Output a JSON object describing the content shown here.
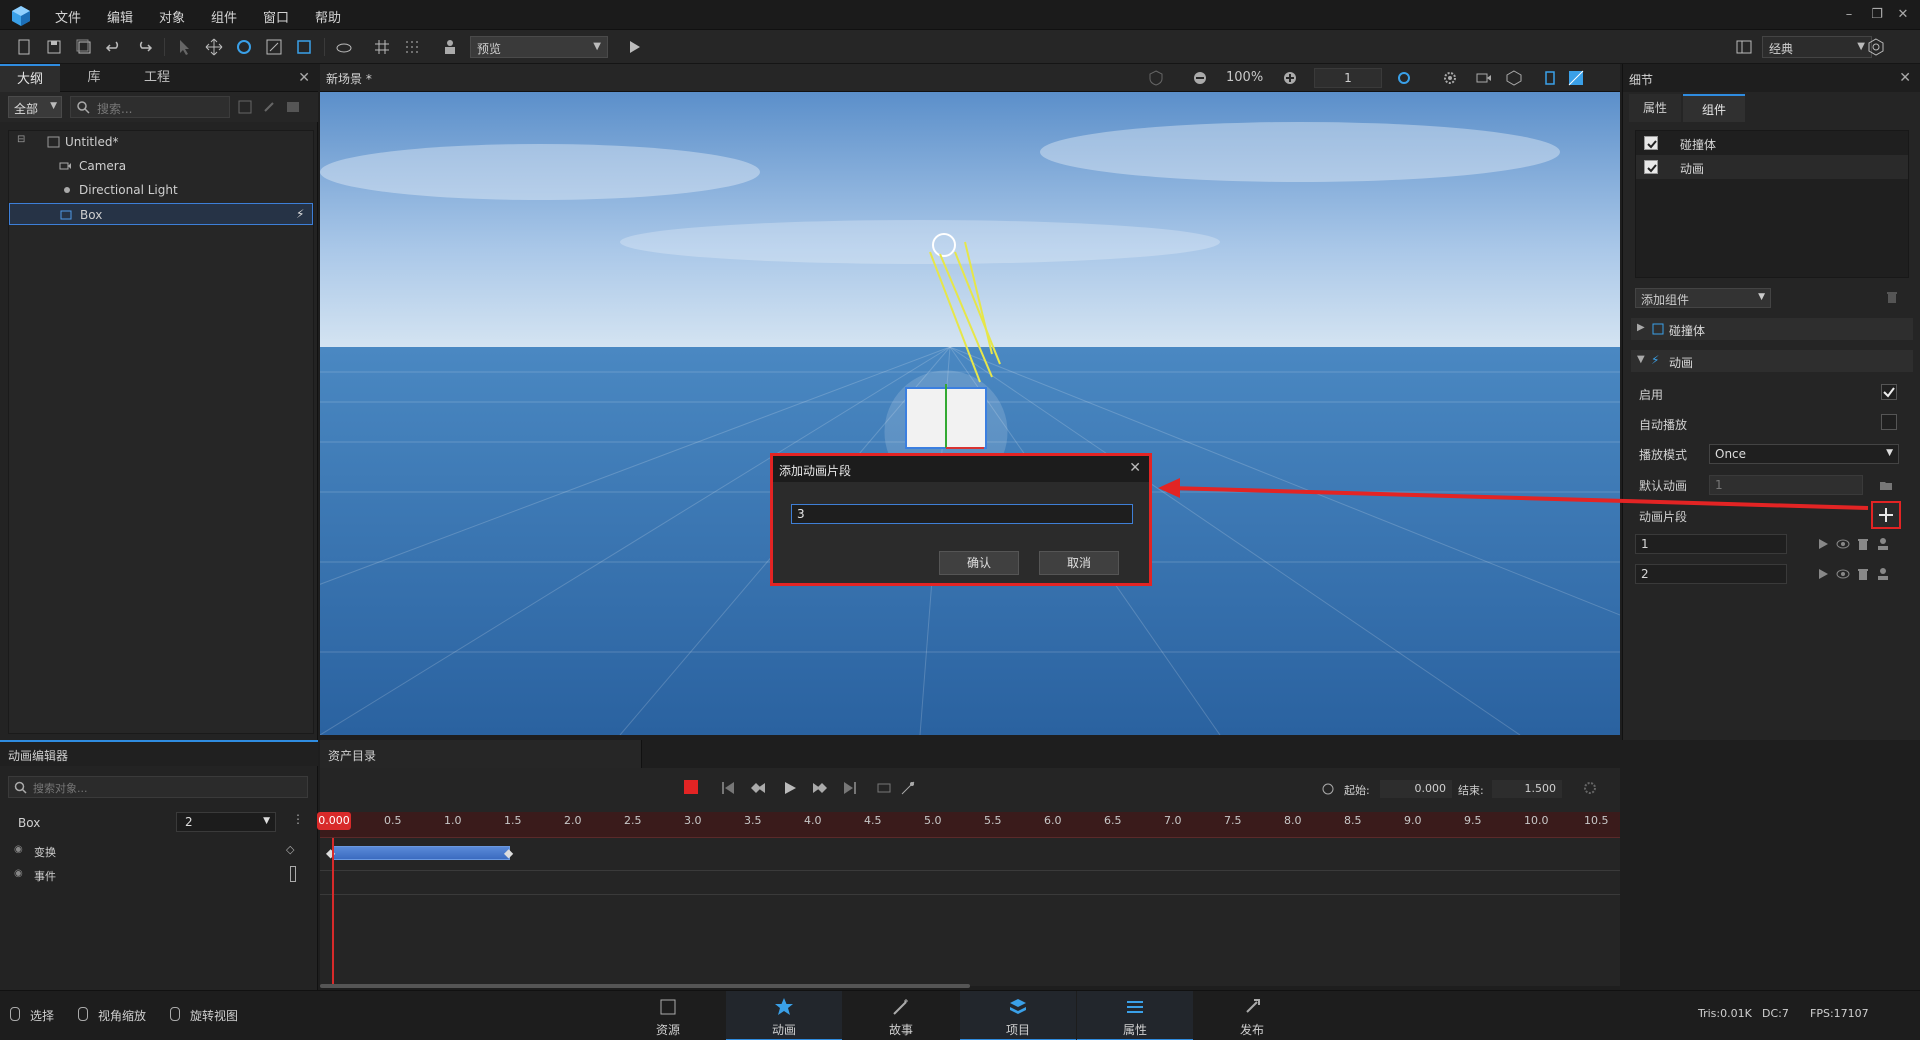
{
  "menu": {
    "items": [
      "文件",
      "编辑",
      "对象",
      "组件",
      "窗口",
      "帮助"
    ]
  },
  "toolbar": {
    "preview_select": "预览",
    "layout_select": "经典"
  },
  "outline": {
    "tabs": [
      "大纲",
      "库",
      "工程"
    ],
    "filter": "全部",
    "search_placeholder": "搜索...",
    "tree": [
      "Untitled*",
      "Camera",
      "Directional Light",
      "Box"
    ]
  },
  "viewport": {
    "title": "新场景 *",
    "zoom": "100%",
    "frame": "1"
  },
  "dialog": {
    "title": "添加动画片段",
    "input_value": "3",
    "confirm": "确认",
    "cancel": "取消"
  },
  "details": {
    "title": "细节",
    "tabs": [
      "属性",
      "组件"
    ],
    "components": [
      "碰撞体",
      "动画"
    ],
    "add_component": "添加组件",
    "sections": [
      "碰撞体",
      "动画"
    ],
    "props": {
      "enabled": "启用",
      "autoplay": "自动播放",
      "play_mode_label": "播放模式",
      "play_mode_value": "Once",
      "default_anim_label": "默认动画",
      "default_anim_value": "1",
      "clips_label": "动画片段"
    },
    "clips": [
      "1",
      "2"
    ]
  },
  "anim_editor": {
    "title": "动画编辑器",
    "search_placeholder": "搜索对象...",
    "object_name": "Box",
    "clip_select": "2",
    "tracks": [
      "变换",
      "事件"
    ]
  },
  "asset_tab": "资产目录",
  "timeline": {
    "start_label": "起始:",
    "start_value": "0.000",
    "end_label": "结束:",
    "end_value": "1.500",
    "playhead": "0.000",
    "ticks": [
      "0.5",
      "1.0",
      "1.5",
      "2.0",
      "2.5",
      "3.0",
      "3.5",
      "4.0",
      "4.5",
      "5.0",
      "5.5",
      "6.0",
      "6.5",
      "7.0",
      "7.5",
      "8.0",
      "8.5",
      "9.0",
      "9.5",
      "10.0",
      "10.5"
    ]
  },
  "status": {
    "tools": [
      "选择",
      "视角缩放",
      "旋转视图"
    ],
    "nav": [
      "资源",
      "动画",
      "故事",
      "项目",
      "属性",
      "发布"
    ],
    "stats": [
      "Tris:0.01K",
      "DC:7",
      "FPS:17107"
    ]
  },
  "colors": {
    "accent": "#2f8ce0",
    "highlight_red": "#e32424"
  }
}
